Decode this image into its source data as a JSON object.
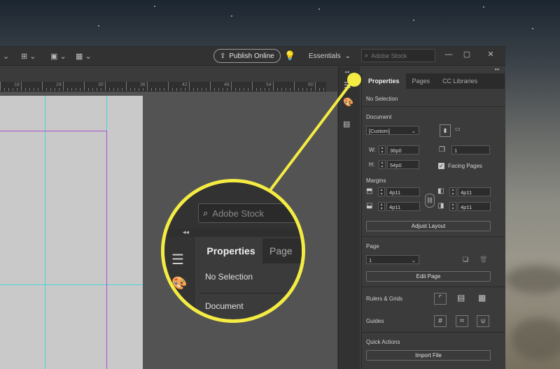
{
  "toolbar": {
    "publish_label": "Publish Online",
    "workspace_label": "Essentials",
    "search_placeholder": "Adobe Stock",
    "window_controls": [
      "—",
      "▢",
      "✕"
    ]
  },
  "ruler": {
    "labels": [
      "18",
      "24",
      "30",
      "36",
      "42",
      "48",
      "54",
      "60"
    ]
  },
  "panel": {
    "tabs": [
      "Properties",
      "Pages",
      "CC Libraries"
    ],
    "selection": "No Selection",
    "document": {
      "heading": "Document",
      "preset": "[Custom]",
      "width_label": "W:",
      "width_value": "36p0",
      "height_label": "H:",
      "height_value": "54p0",
      "pages_value": "1",
      "facing_pages_label": "Facing Pages"
    },
    "margins": {
      "heading": "Margins",
      "top": "4p11",
      "bottom": "4p11",
      "left": "4p11",
      "right": "4p11",
      "adjust_layout_label": "Adjust Layout"
    },
    "page": {
      "heading": "Page",
      "page_value": "1",
      "edit_page_label": "Edit Page"
    },
    "rulers_grids_label": "Rulers & Grids",
    "guides_label": "Guides",
    "quick_actions": {
      "heading": "Quick Actions",
      "import_file_label": "Import File"
    }
  },
  "magnifier": {
    "search_placeholder": "Adobe Stock",
    "tab_active": "Properties",
    "tab_partial": "Page",
    "selection": "No Selection",
    "document": "Document"
  },
  "colors": {
    "callout": "#f4ec43",
    "guide": "#49d4d4",
    "margin": "#b04fd0"
  }
}
